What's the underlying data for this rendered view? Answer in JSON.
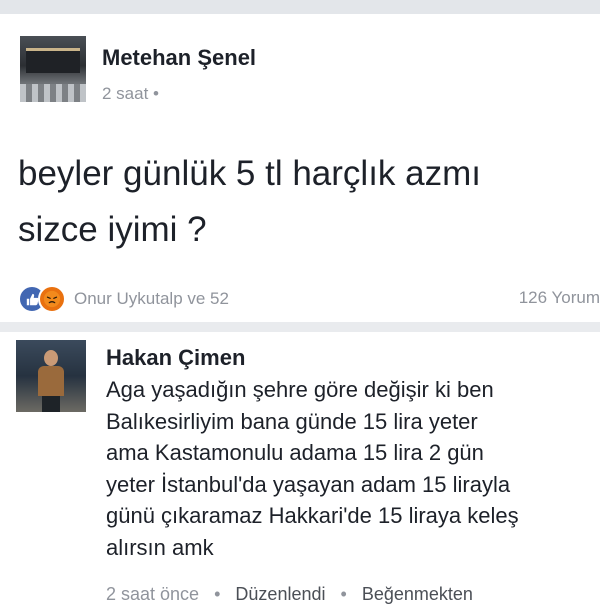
{
  "post": {
    "author": "Metehan Şenel",
    "time": "2 saat",
    "privacy_dot": "•",
    "text_line1": "beyler günlük 5 tl harçlık azmı",
    "text_line2": "sizce iyimi ?",
    "reactions_text": "Onur Uykutalp ve 52",
    "comment_count": "126 Yorum"
  },
  "comment": {
    "author": "Hakan Çimen",
    "lines": [
      "Aga yaşadığın şehre göre değişir ki ben",
      "Balıkesirliyim bana günde 15 lira yeter",
      "ama Kastamonulu adama 15 lira 2 gün",
      "yeter İstanbul'da yaşayan adam 15 lirayla",
      "günü çıkaramaz Hakkari'de 15 liraya keleş",
      "alırsın amk"
    ],
    "time": "2 saat önce",
    "edited": "Düzenlendi",
    "unlike": "Beğenmekten",
    "sep": "•"
  },
  "colors": {
    "like_blue": "#4267b2",
    "angry_orange": "#e9710f",
    "meta_gray": "#90949c",
    "text_dark": "#1d2129"
  }
}
